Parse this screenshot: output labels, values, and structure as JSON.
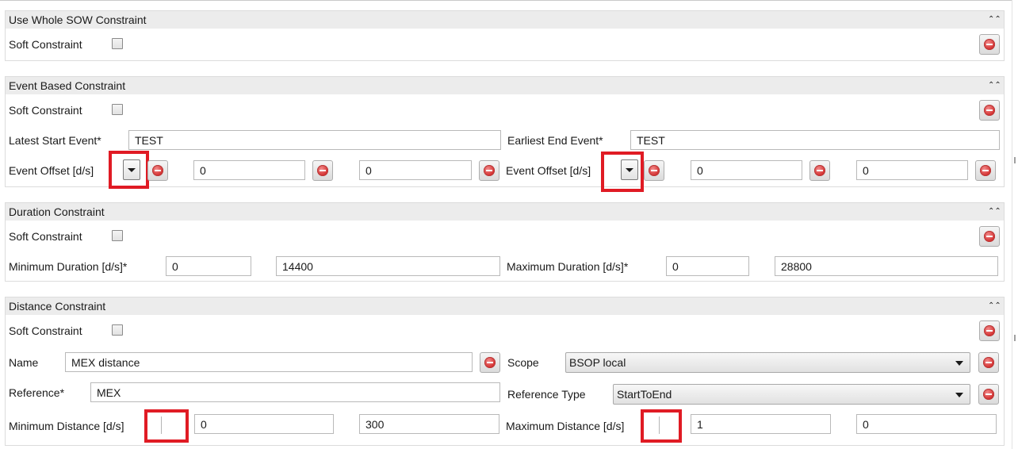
{
  "panels": {
    "whole_sow": {
      "title": "Use Whole SOW Constraint",
      "collapse_icon": "double-chevron-up-icon",
      "soft_constraint_label": "Soft Constraint",
      "soft_constraint_checked": false
    },
    "event_based": {
      "title": "Event Based Constraint",
      "collapse_icon": "double-chevron-up-icon",
      "soft_constraint_label": "Soft Constraint",
      "soft_constraint_checked": false,
      "latest_start_label": "Latest Start Event*",
      "latest_start_value": "TEST",
      "earliest_end_label": "Earliest End Event*",
      "earliest_end_value": "TEST",
      "left_offset_label": "Event Offset [d/s]",
      "left_offset_days": "0",
      "left_offset_seconds": "0",
      "right_offset_label": "Event Offset [d/s]",
      "right_offset_days": "0",
      "right_offset_seconds": "0"
    },
    "duration": {
      "title": "Duration Constraint",
      "collapse_icon": "double-chevron-up-icon",
      "soft_constraint_label": "Soft Constraint",
      "soft_constraint_checked": false,
      "min_label": "Minimum Duration [d/s]*",
      "min_days": "0",
      "min_seconds": "14400",
      "max_label": "Maximum Duration [d/s]*",
      "max_days": "0",
      "max_seconds": "28800"
    },
    "distance": {
      "title": "Distance Constraint",
      "collapse_icon": "double-chevron-up-icon",
      "soft_constraint_label": "Soft Constraint",
      "soft_constraint_checked": false,
      "name_label": "Name",
      "name_value": "MEX distance",
      "scope_label": "Scope",
      "scope_value": "BSOP local",
      "reference_label": "Reference*",
      "reference_value": "MEX",
      "reference_type_label": "Reference Type",
      "reference_type_value": "StartToEnd",
      "min_label": "Minimum Distance [d/s]",
      "min_days": "0",
      "min_seconds": "300",
      "max_label": "Maximum Distance [d/s]",
      "max_days": "1",
      "max_seconds": "0"
    }
  },
  "colors": {
    "highlight": "#e01b24",
    "panel_header": "#ececec",
    "remove_icon": "#d22b2b"
  },
  "icons": {
    "remove": "remove-circle-icon",
    "dropdown": "dropdown-arrow-icon",
    "collapse": "double-chevron-up-icon"
  }
}
